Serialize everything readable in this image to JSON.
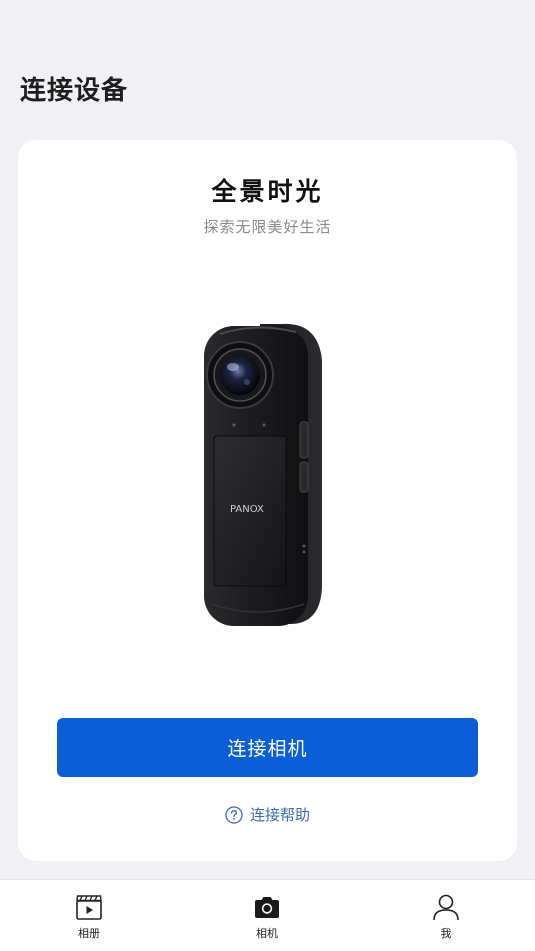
{
  "header": {
    "title": "连接设备"
  },
  "card": {
    "title": "全景时光",
    "subtitle": "探索无限美好生活",
    "device_brand": "PANOX",
    "connect_button_label": "连接相机",
    "help_link_label": "连接帮助"
  },
  "tabbar": {
    "items": [
      {
        "label": "相册",
        "icon": "clapperboard-play-icon"
      },
      {
        "label": "相机",
        "icon": "camera-icon"
      },
      {
        "label": "我",
        "icon": "person-icon"
      }
    ]
  },
  "colors": {
    "background": "#f0f0f5",
    "card": "#ffffff",
    "primary_button": "#0a5fd8",
    "link": "#3a6cb0"
  }
}
